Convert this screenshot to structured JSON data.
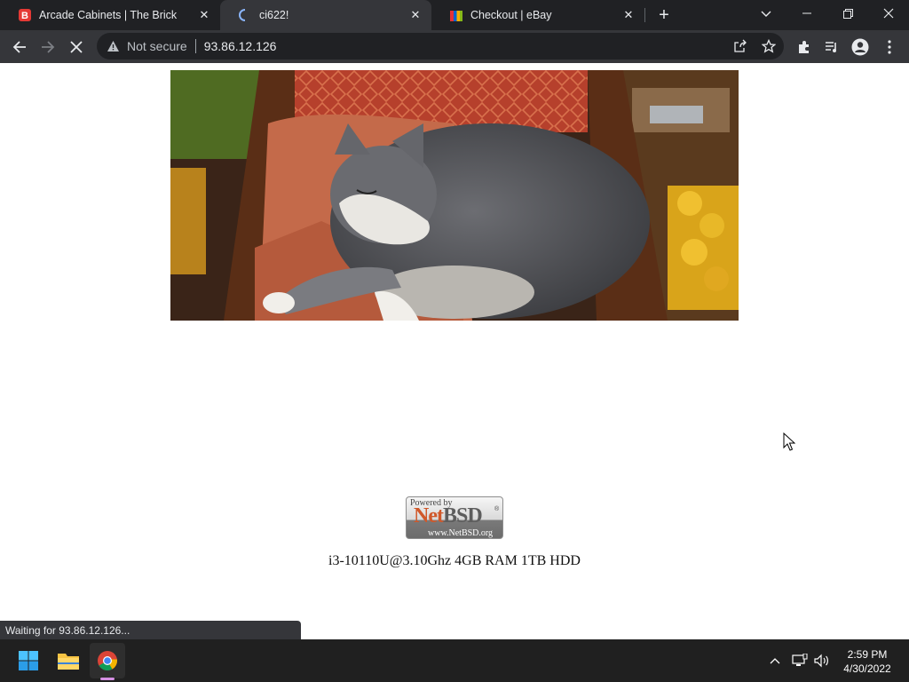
{
  "browser": {
    "tabs": [
      {
        "title": "Arcade Cabinets | The Brick",
        "icon": "brick-favicon-icon",
        "active": false
      },
      {
        "title": "ci622!",
        "icon": "loading-spinner-icon",
        "active": true
      },
      {
        "title": "Checkout | eBay",
        "icon": "ebay-favicon-icon",
        "active": false
      }
    ],
    "address_bar": {
      "security_label": "Not secure",
      "url": "93.86.12.126"
    },
    "status_text": "Waiting for 93.86.12.126..."
  },
  "page": {
    "photo_alt": "Sleeping gray and white cat on a chair cushion",
    "badge": {
      "powered_by": "Powered by",
      "logo_net": "Net",
      "logo_bsd": "BSD",
      "registered": "®",
      "site": "www.NetBSD.org"
    },
    "specs": "i3-10110U@3.10Ghz 4GB RAM 1TB HDD"
  },
  "taskbar": {
    "time": "2:59 PM",
    "date": "4/30/2022"
  },
  "colors": {
    "tab_strip": "#202124",
    "toolbar": "#35363a",
    "taskbar": "#202020",
    "netbsd_orange": "#d0582a"
  }
}
